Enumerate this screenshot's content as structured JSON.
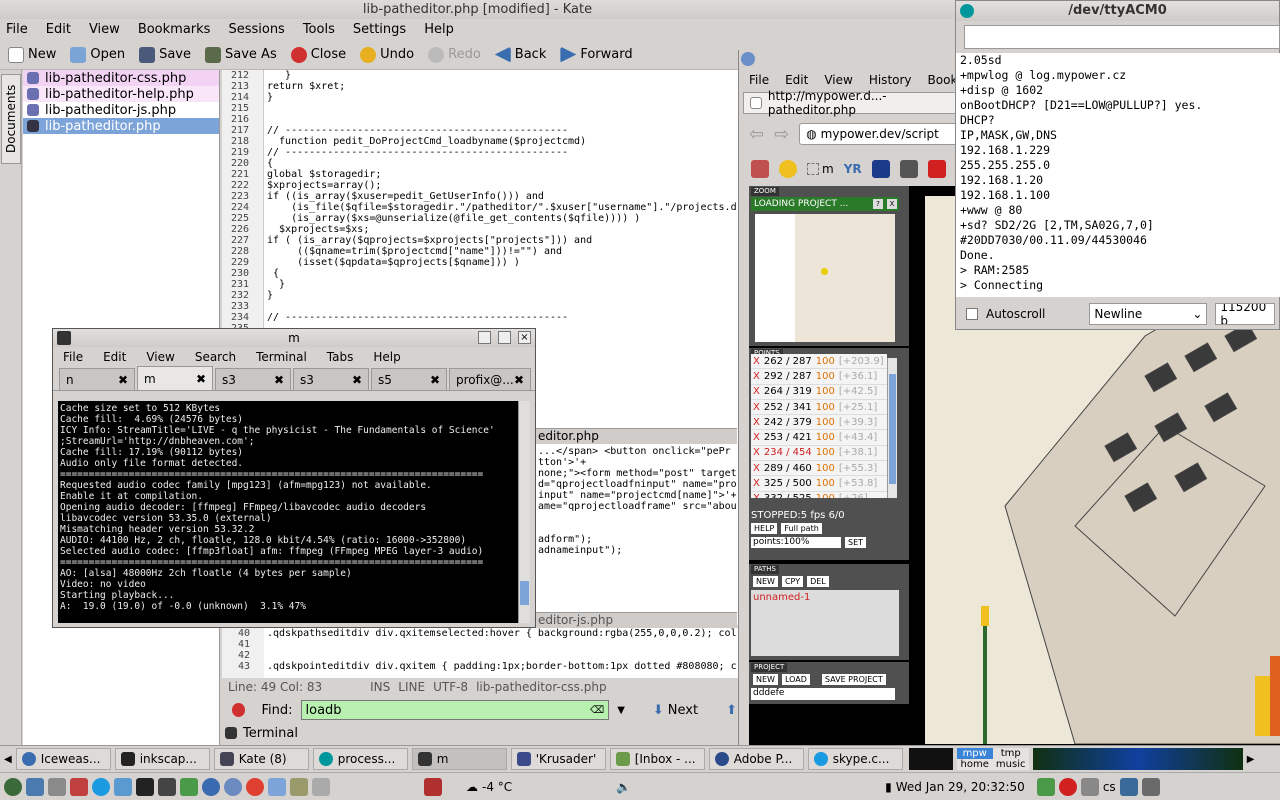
{
  "kate": {
    "title": "lib-patheditor.php [modified] - Kate",
    "menu": [
      "File",
      "Edit",
      "View",
      "Bookmarks",
      "Sessions",
      "Tools",
      "Settings",
      "Help"
    ],
    "toolbar": {
      "new": "New",
      "open": "Open",
      "save": "Save",
      "save_as": "Save As",
      "close": "Close",
      "undo": "Undo",
      "redo": "Redo",
      "back": "Back",
      "forward": "Forward"
    },
    "side_tab": "Documents",
    "documents": [
      "lib-patheditor-css.php",
      "lib-patheditor-help.php",
      "lib-patheditor-js.php",
      "lib-patheditor.php"
    ],
    "line_numbers": [
      "212",
      "213",
      "214",
      "215",
      "216",
      "217",
      "218",
      "219",
      "220",
      "221",
      "222",
      "223",
      "224",
      "225",
      "226",
      "227",
      "228",
      "229",
      "230",
      "231",
      "232",
      "233",
      "234",
      "235"
    ],
    "code_lines": [
      "   }",
      "return $xret;",
      "}",
      "",
      "",
      "// -----------------------------------------------",
      "  function pedit_DoProjectCmd_loadbyname($projectcmd)",
      "// -----------------------------------------------",
      "{",
      "global $storagedir;",
      "$xprojects=array();",
      "if ((is_array($xuser=pedit_GetUserInfo())) and",
      "    (is_file($qfile=$storagedir.\"/patheditor/\".$xuser[\"username\"].\"/projects.d",
      "    (is_array($xs=@unserialize(@file_get_contents($qfile)))) )",
      "  $xprojects=$xs;",
      "if ( (is_array($qprojects=$xprojects[\"projects\"])) and",
      "     (($qname=trim($projectcmd[\"name\"]))!=\"\") and",
      "     (isset($qpdata=$qprojects[$qname])) )",
      " {",
      "  }",
      "}",
      "",
      "// -----------------------------------------------",
      ""
    ],
    "code_behind": [
      "       $xuser[\"username\"].\"/projects.d",
      "       ents($qfile)))) )"
    ],
    "tab_mid": "editor.php",
    "code_mid": [
      "...</span> <button onclick=\"pePr",
      "tton'>'+",
      "none;\"><form method=\"post\" target",
      "d=\"qprojectloadfninput\" name=\"pro",
      "input\" name=\"projectcmd[name]\">'+",
      "ame=\"qprojectloadframe\" src=\"abou",
      "",
      "",
      "adform\");",
      "adnameinput\");"
    ],
    "tab_low": "editor-js.php",
    "line_numbers2": [
      "40",
      "41",
      "42",
      "43"
    ],
    "code_lines2": [
      ".qdskpathseditdiv div.qxitemselected:hover { background:rgba(255,0,0,0.2); col",
      "",
      "",
      ".qdskpointeditdiv div.qxitem { padding:1px;border-bottom:1px dotted #808080; c"
    ],
    "status": {
      "pos": "Line: 49 Col: 83",
      "mode": "INS",
      "sel": "LINE",
      "enc": "UTF-8",
      "file": "lib-patheditor-css.php"
    },
    "find": {
      "label": "Find:",
      "value": "loadb",
      "next": "Next"
    },
    "terminal_tab": "Terminal"
  },
  "term": {
    "title": "m",
    "menu": [
      "File",
      "Edit",
      "View",
      "Search",
      "Terminal",
      "Tabs",
      "Help"
    ],
    "tabs": [
      "n",
      "m",
      "s3",
      "s3",
      "s5",
      "profix@..."
    ],
    "lines": [
      "Cache size set to 512 KBytes",
      "Cache fill:  4.69% (24576 bytes)",
      "ICY Info: StreamTitle='LIVE - q the physicist - The Fundamentals of Science'",
      ";StreamUrl='http://dnbheaven.com';",
      "Cache fill: 17.19% (90112 bytes)",
      "",
      "Audio only file format detected.",
      "==========================================================================",
      "Requested audio codec family [mpg123] (afm=mpg123) not available.",
      "Enable it at compilation.",
      "Opening audio decoder: [ffmpeg] FFmpeg/libavcodec audio decoders",
      "libavcodec version 53.35.0 (external)",
      "Mismatching header version 53.32.2",
      "AUDIO: 44100 Hz, 2 ch, floatle, 128.0 kbit/4.54% (ratio: 16000->352800)",
      "Selected audio codec: [ffmp3float] afm: ffmpeg (FFmpeg MPEG layer-3 audio)",
      "==========================================================================",
      "AO: [alsa] 48000Hz 2ch floatle (4 bytes per sample)",
      "Video: no video",
      "Starting playback...",
      "A:  19.0 (19.0) of -0.0 (unknown)  3.1% 47%"
    ]
  },
  "browser": {
    "menu": [
      "File",
      "Edit",
      "View",
      "History",
      "Bookmar"
    ],
    "tab_title": "http://mypower.d...-patheditor.php",
    "url": "mypower.dev/script",
    "bm_m": "m",
    "bm_yr": "YR",
    "zoom_label": "ZOOM",
    "loading": "LOADING PROJECT ...",
    "loading_help": "?",
    "loading_close": "X",
    "points_label": "POINTS",
    "points": [
      {
        "c": "262 / 287",
        "v": "100",
        "d": "[+203.9]"
      },
      {
        "c": "292 / 287",
        "v": "100",
        "d": "[+36.1]"
      },
      {
        "c": "264 / 319",
        "v": "100",
        "d": "[+42.5]"
      },
      {
        "c": "252 / 341",
        "v": "100",
        "d": "[+25.1]"
      },
      {
        "c": "242 / 379",
        "v": "100",
        "d": "[+39.3]"
      },
      {
        "c": "253 / 421",
        "v": "100",
        "d": "[+43.4]"
      },
      {
        "c": "234 / 454",
        "v": "100",
        "d": "[+38.1]"
      },
      {
        "c": "289 / 460",
        "v": "100",
        "d": "[+55.3]"
      },
      {
        "c": "325 / 500",
        "v": "100",
        "d": "[+53.8]"
      },
      {
        "c": "332 / 525",
        "v": "100",
        "d": "[+26]"
      }
    ],
    "point_x": "X",
    "stopped": "STOPPED:5 fps 6/0",
    "help": "HELP",
    "fullpath": "Full path",
    "points_zoom": "points:100%",
    "set": "SET",
    "paths_label": "PATHS",
    "paths_btns": [
      "NEW",
      "CPY",
      "DEL"
    ],
    "path_name": "unnamed-1",
    "project_label": "PROJECT",
    "project_btns": [
      "NEW",
      "LOAD",
      "SAVE PROJECT"
    ],
    "project_name": "dddefe"
  },
  "serial": {
    "title": "/dev/ttyACM0",
    "lines": [
      "2.05sd",
      "+mpwlog @ log.mypower.cz",
      "+disp @ 1602",
      "onBootDHCP? [D21==LOW@PULLUP?] yes.",
      "DHCP?",
      "IP,MASK,GW,DNS",
      "192.168.1.229",
      "255.255.255.0",
      "192.168.1.20",
      "192.168.1.100",
      "+www @ 80",
      "+sd? SD2/2G [2,TM,SA02G,7,0]",
      "#20DD7030/00.11.09/44530046",
      "Done.",
      "> RAM:2585",
      "> Connecting"
    ],
    "autoscroll": "Autoscroll",
    "newline": "Newline",
    "baud": "115200 b"
  },
  "taskbar": {
    "tasks": [
      "Iceweas...",
      "inkscap...",
      "Kate (8)",
      "process...",
      "m",
      "'Krusader'",
      "[Inbox - ...",
      "Adobe P...",
      "skype.c..."
    ],
    "mpw": "mpw",
    "tmp": "tmp",
    "home": "home",
    "music": "music"
  },
  "tray": {
    "temp": "-4 °C",
    "clock": "Wed Jan 29, 20:32:50",
    "cs": "cs"
  },
  "colors": {
    "accent": "#3a84d8",
    "green": "#b8f0b0",
    "selection": "#7da4d8",
    "doc_pink": "#f3d3f3",
    "serial_cyan": "#00979c"
  }
}
